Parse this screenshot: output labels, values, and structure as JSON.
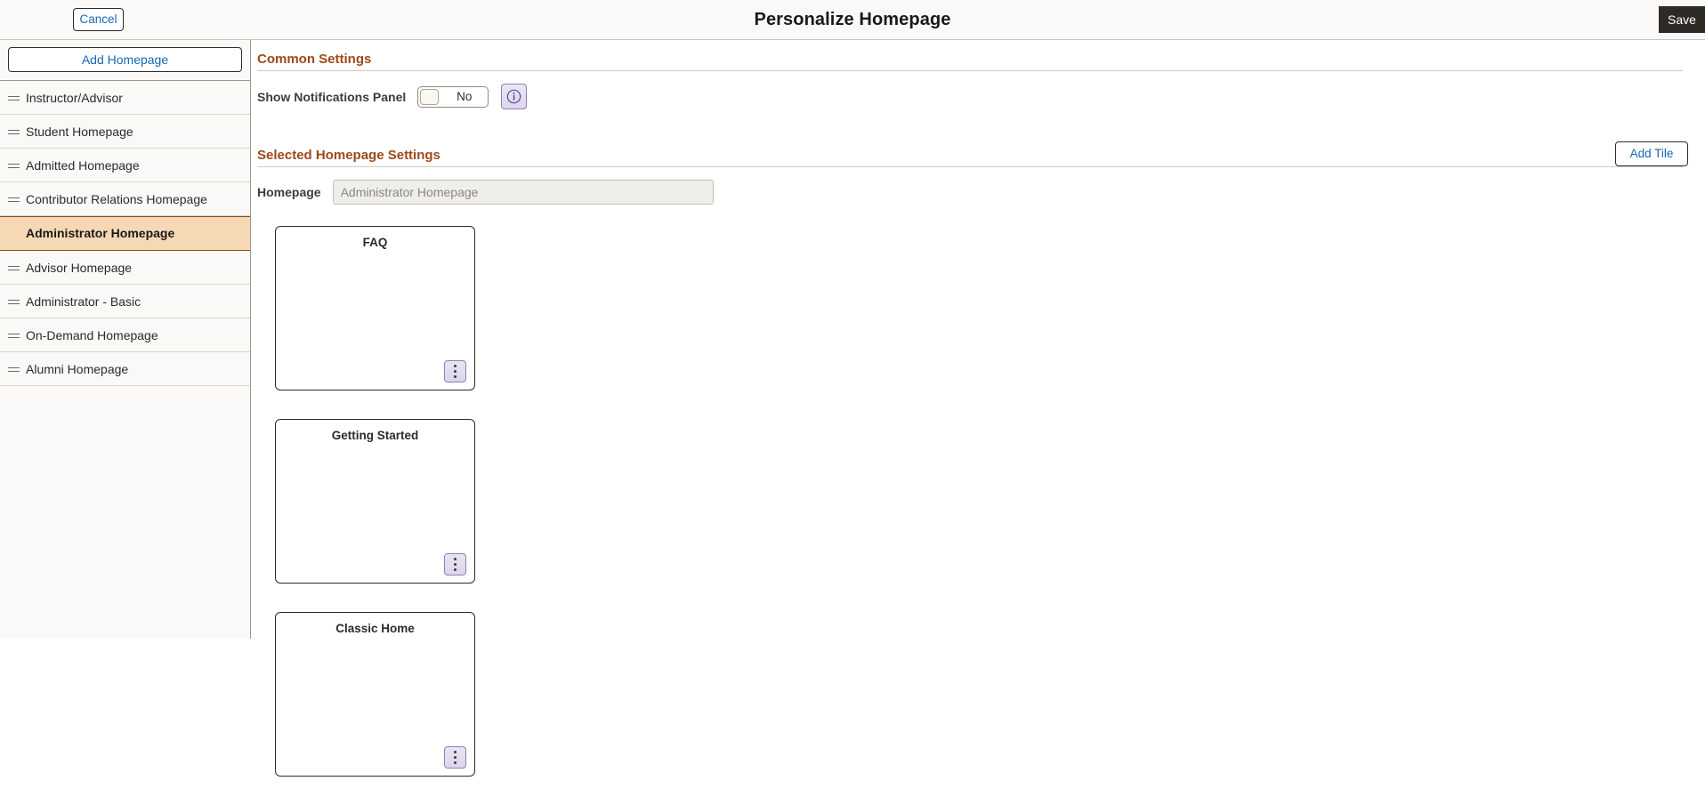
{
  "header": {
    "title": "Personalize Homepage",
    "cancel_label": "Cancel",
    "save_label": "Save"
  },
  "sidebar": {
    "add_homepage_label": "Add Homepage",
    "items": [
      {
        "label": "Instructor/Advisor",
        "selected": false
      },
      {
        "label": "Student Homepage",
        "selected": false
      },
      {
        "label": "Admitted Homepage",
        "selected": false
      },
      {
        "label": "Contributor Relations Homepage",
        "selected": false
      },
      {
        "label": "Administrator Homepage",
        "selected": true
      },
      {
        "label": "Advisor Homepage",
        "selected": false
      },
      {
        "label": "Administrator - Basic",
        "selected": false
      },
      {
        "label": "On-Demand Homepage",
        "selected": false
      },
      {
        "label": "Alumni Homepage",
        "selected": false
      }
    ]
  },
  "common_settings": {
    "heading": "Common Settings",
    "notifications_label": "Show Notifications Panel",
    "notifications_value": "No",
    "info_icon": "info-circle-icon"
  },
  "selected_homepage_settings": {
    "heading": "Selected Homepage Settings",
    "add_tile_label": "Add Tile",
    "homepage_label": "Homepage",
    "homepage_value": "Administrator Homepage",
    "tiles": [
      {
        "title": "FAQ",
        "menu_icon": "vertical-ellipsis-icon"
      },
      {
        "title": "Getting Started",
        "menu_icon": "vertical-ellipsis-icon"
      },
      {
        "title": "Classic Home",
        "menu_icon": "vertical-ellipsis-icon"
      }
    ]
  },
  "colors": {
    "accent_heading": "#9c4a1a",
    "selected_item_bg": "#f6d9b4",
    "selected_item_border": "#8b4a1e",
    "link_blue": "#1668b3",
    "save_bg": "#2e2a26",
    "purple_button": "#8c80b5"
  }
}
